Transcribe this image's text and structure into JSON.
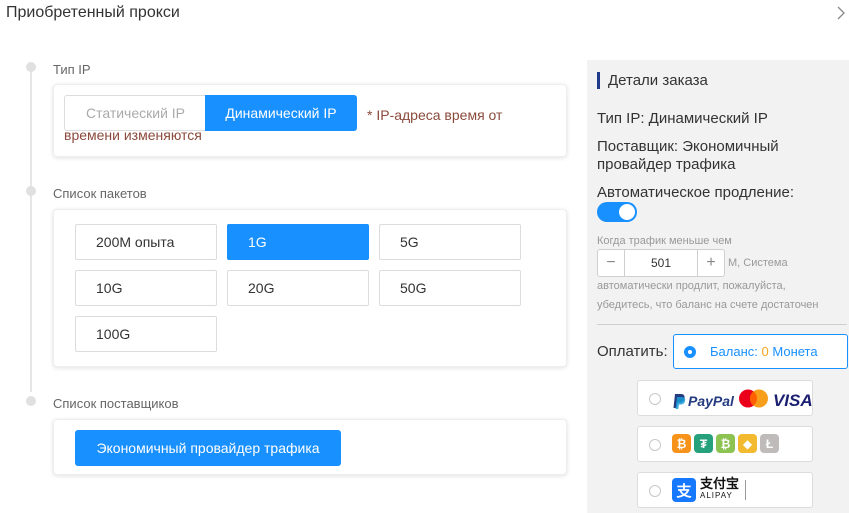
{
  "header": {
    "title": "Приобретенный прокси"
  },
  "steps": {
    "ip_type": {
      "label": "Тип IP",
      "options": [
        "Статический IP",
        "Динамический IP"
      ],
      "note": "* IP-адреса время от времени изменяются"
    },
    "packages": {
      "label": "Список пакетов",
      "items": [
        "200M опыта",
        "1G",
        "5G",
        "10G",
        "20G",
        "50G",
        "100G"
      ],
      "selected": "1G"
    },
    "providers": {
      "label": "Список поставщиков",
      "selected_provider": "Экономичный провайдер трафика"
    }
  },
  "order": {
    "title": "Детали заказа",
    "ip_type_line": "Тип IP: Динамический IP",
    "provider_line": "Поставщик: Экономичный провайдер трафика",
    "auto_renew_label": "Автоматическое продление:",
    "auto_renew_on": true,
    "threshold_prefix": "Когда трафик меньше чем",
    "threshold_value": "501",
    "threshold_suffix": "M,   Система",
    "threshold_note_1": "автоматически продлит, пожалуйста,",
    "threshold_note_2": "убедитесь, что баланс на счете достаточен",
    "pay_label": "Оплатить:",
    "balance_prefix": "Баланс:",
    "balance_amount": "0",
    "balance_unit": "Монета",
    "paypal_brand": "PayPal",
    "visa_brand": "VISA",
    "alipay_brand": "支付宝",
    "alipay_sub": "ALIPAY",
    "coins": [
      "bitcoin-icon",
      "tether-icon",
      "bitcoin-cash-icon",
      "binance-icon",
      "litecoin-icon"
    ]
  },
  "colors": {
    "accent": "#1890ff",
    "note": "#8b4a3c",
    "balance_zero": "#f5a623"
  }
}
